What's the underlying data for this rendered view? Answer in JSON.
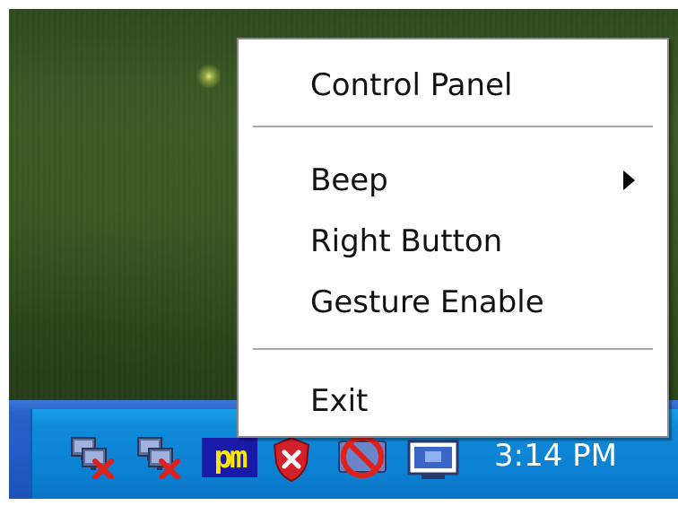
{
  "context_menu": {
    "items": [
      {
        "label": "Control Panel"
      },
      {
        "label": "Beep",
        "has_submenu": true
      },
      {
        "label": "Right Button"
      },
      {
        "label": "Gesture Enable"
      },
      {
        "label": "Exit"
      }
    ]
  },
  "taskbar": {
    "clock": "3:14 PM",
    "tray_icons": [
      "network-disconnected-icon",
      "network-disconnected-icon",
      "pm-app-icon",
      "security-shield-icon",
      "no-sign-icon",
      "monitor-icon"
    ],
    "pm_icon_text": "pm"
  },
  "colors": {
    "taskbar_blue": "#245bc4",
    "tray_blue": "#0f8ad9",
    "menu_bg": "#ffffff",
    "pm_icon_bg": "#1a1aa8",
    "pm_icon_text": "#ffe600",
    "error_red": "#e0201a"
  }
}
